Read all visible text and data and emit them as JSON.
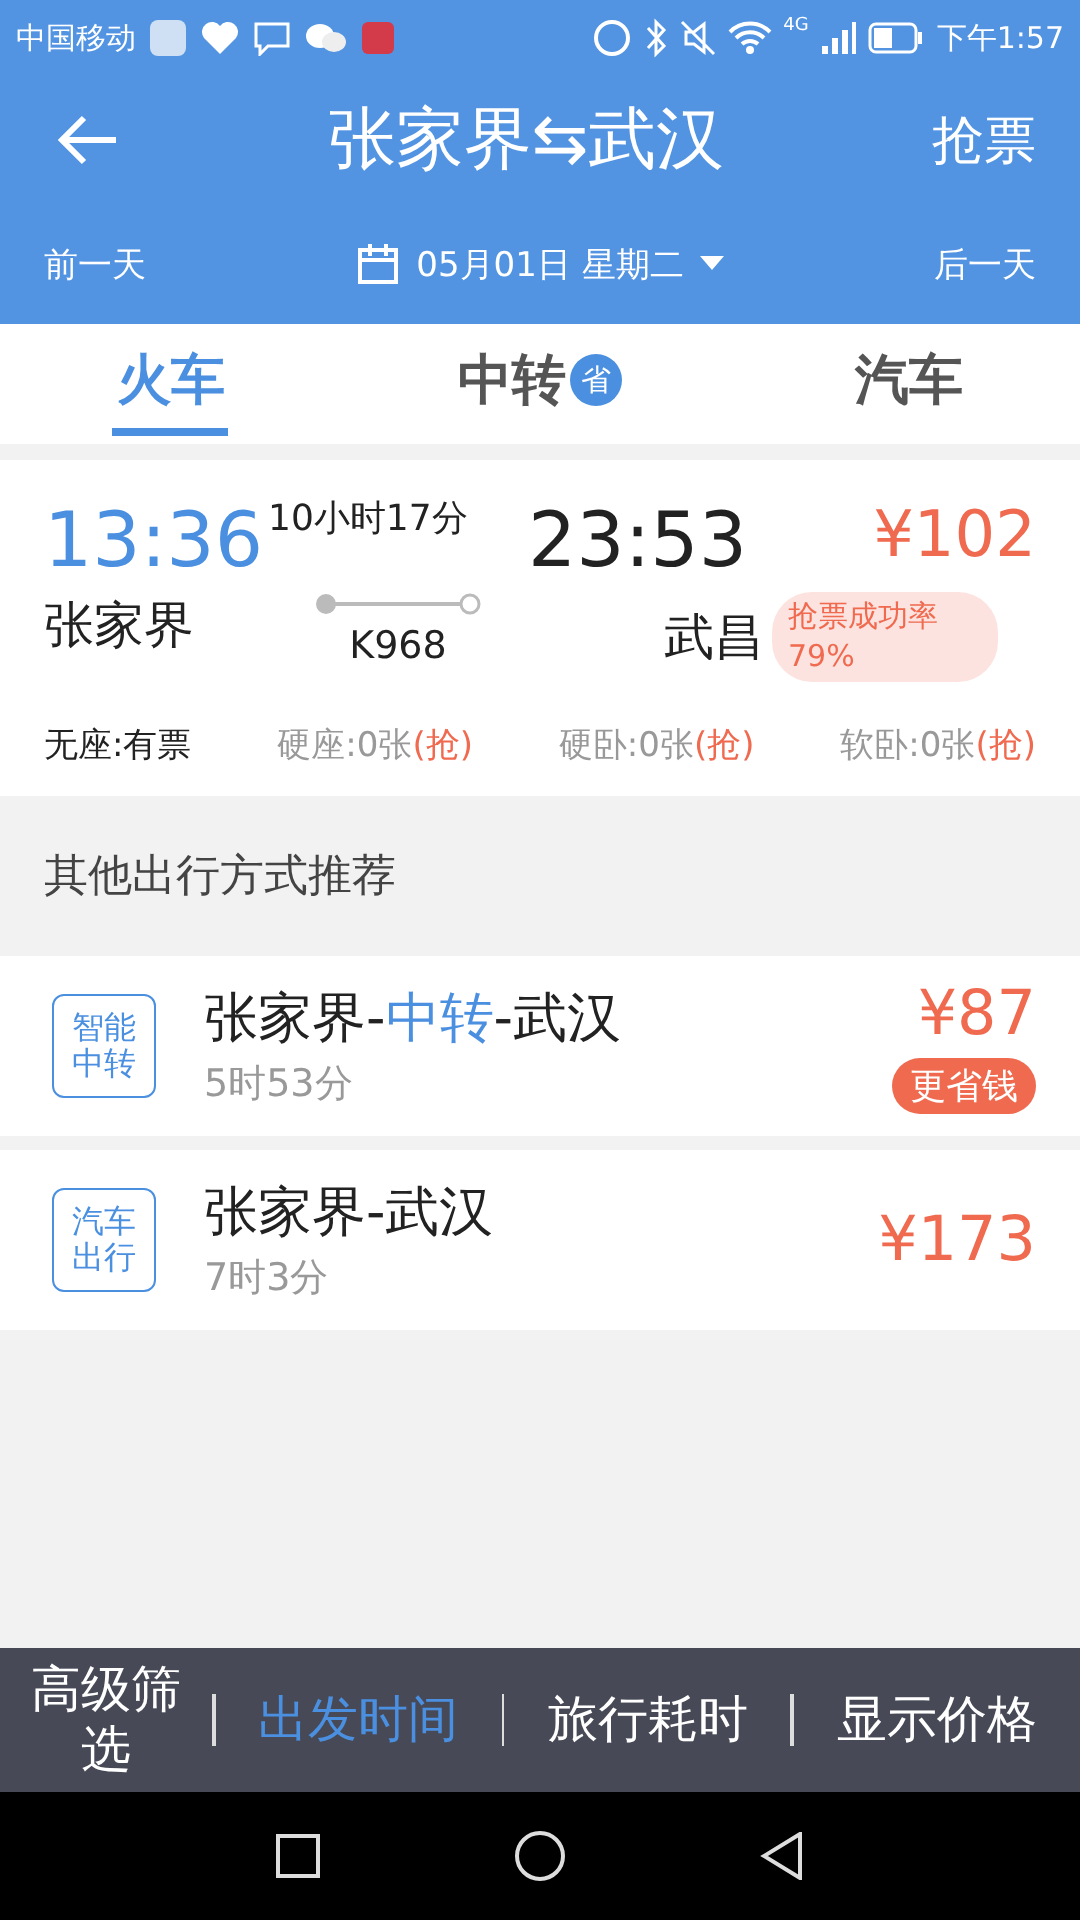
{
  "status_bar": {
    "carrier": "中国移动",
    "network": "4G",
    "time": "下午1:57"
  },
  "header": {
    "title": "张家界⇆武汉",
    "action": "抢票",
    "prev_day": "前一天",
    "date": "05月01日 星期二",
    "next_day": "后一天"
  },
  "tabs": [
    {
      "label": "火车",
      "selected": true
    },
    {
      "label": "中转",
      "selected": false,
      "badge": "省"
    },
    {
      "label": "汽车",
      "selected": false
    }
  ],
  "train": {
    "depart_time": "13:36",
    "duration": "10小时17分",
    "arrive_time": "23:53",
    "price": "¥102",
    "from": "张家界",
    "number": "K968",
    "to": "武昌",
    "success_rate": "抢票成功率79%",
    "seats": [
      {
        "label": "无座:有票",
        "available": true
      },
      {
        "label": "硬座:0张",
        "available": false,
        "action": "(抢)"
      },
      {
        "label": "硬卧:0张",
        "available": false,
        "action": "(抢)"
      },
      {
        "label": "软卧:0张",
        "available": false,
        "action": "(抢)"
      }
    ]
  },
  "other_section": {
    "title": "其他出行方式推荐",
    "options": [
      {
        "tag": "智能中转",
        "title_parts": [
          {
            "text": "张家界-",
            "highlight": false
          },
          {
            "text": "中转",
            "highlight": true
          },
          {
            "text": "-武汉",
            "highlight": false
          }
        ],
        "duration": "5时53分",
        "price": "¥87",
        "badge": "更省钱"
      },
      {
        "tag": "汽车出行",
        "title_parts": [
          {
            "text": "张家界-武汉",
            "highlight": false
          }
        ],
        "duration": "7时3分",
        "price": "¥173"
      }
    ]
  },
  "sort_bar": [
    {
      "label": "高级筛选",
      "selected": false
    },
    {
      "label": "出发时间",
      "selected": true
    },
    {
      "label": "旅行耗时",
      "selected": false
    },
    {
      "label": "显示价格",
      "selected": false
    }
  ]
}
